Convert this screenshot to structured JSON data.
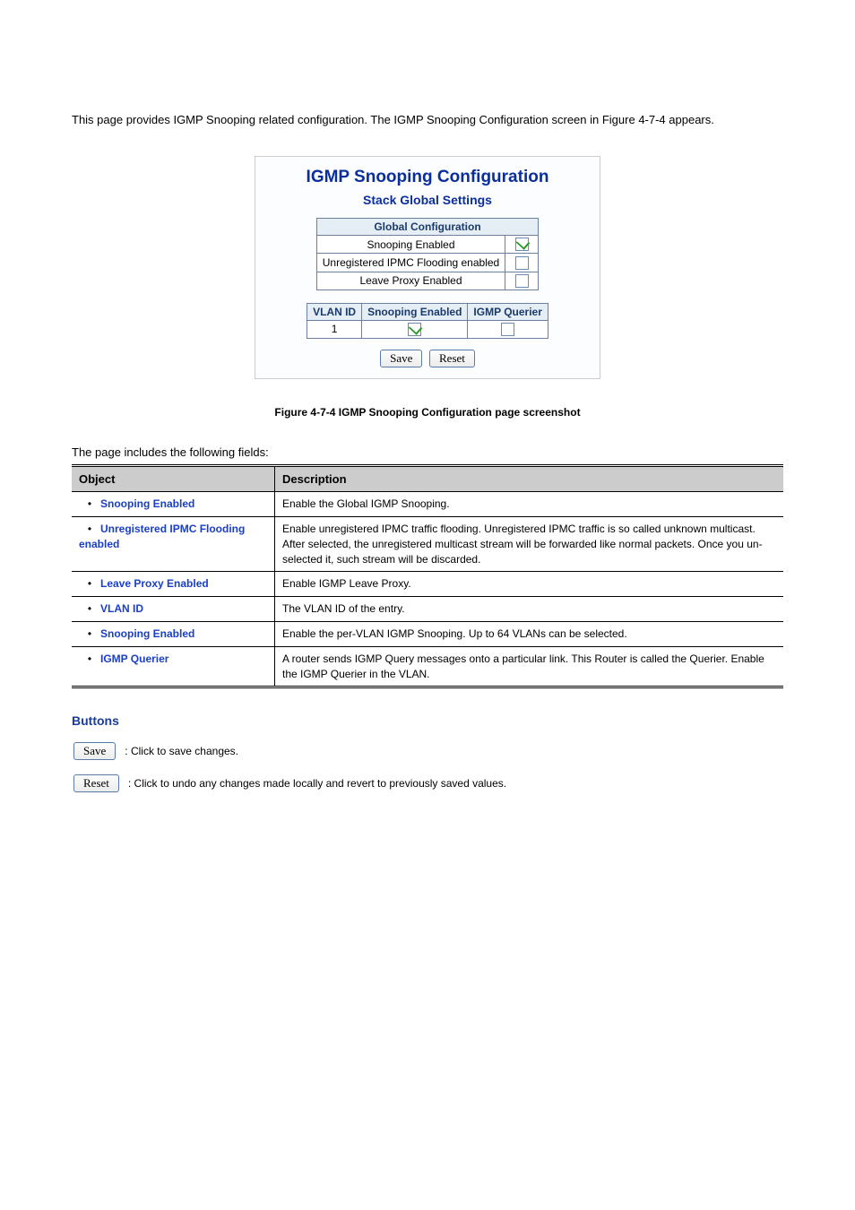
{
  "pre_text": "This page provides IGMP Snooping related configuration. The IGMP Snooping Configuration screen in Figure 4-7-4 appears.",
  "panel": {
    "title": "IGMP Snooping Configuration",
    "subtitle": "Stack Global Settings",
    "global_header": "Global Configuration",
    "rows": [
      {
        "label": "Snooping Enabled",
        "checked": true
      },
      {
        "label": "Unregistered IPMC Flooding enabled",
        "checked": false
      },
      {
        "label": "Leave Proxy Enabled",
        "checked": false
      }
    ],
    "vlan_headers": [
      "VLAN ID",
      "Snooping Enabled",
      "IGMP Querier"
    ],
    "vlan_rows": [
      {
        "id": "1",
        "snooping": true,
        "querier": false
      }
    ],
    "save": "Save",
    "reset": "Reset"
  },
  "figure_caption": "Figure 4-7-4 IGMP Snooping Configuration page screenshot",
  "desc_intro": "The page includes the following fields:",
  "desc_headers": [
    "Object",
    "Description"
  ],
  "desc_rows": [
    {
      "obj": "Snooping Enabled",
      "desc": "Enable the Global IGMP Snooping."
    },
    {
      "obj": "Unregistered IPMC Flooding enabled",
      "desc": "Enable unregistered IPMC traffic flooding. Unregistered IPMC traffic is so called unknown multicast. After selected, the unregistered multicast stream will be forwarded like normal packets. Once you un-selected it, such stream will be discarded."
    },
    {
      "obj": "Leave Proxy Enabled",
      "desc": "Enable IGMP Leave Proxy."
    },
    {
      "obj": "VLAN ID",
      "desc": "The VLAN ID of the entry."
    },
    {
      "obj": "Snooping Enabled",
      "desc": "Enable the per-VLAN IGMP Snooping. Up to 64 VLANs can be selected."
    },
    {
      "obj": "IGMP Querier",
      "desc": "A router sends IGMP Query messages onto a particular link. This Router is called the Querier. Enable the IGMP Querier in the VLAN."
    }
  ],
  "buttons_header": "Buttons",
  "save_desc": ": Click to save changes.",
  "reset_desc": ": Click to undo any changes made locally and revert to previously saved values."
}
